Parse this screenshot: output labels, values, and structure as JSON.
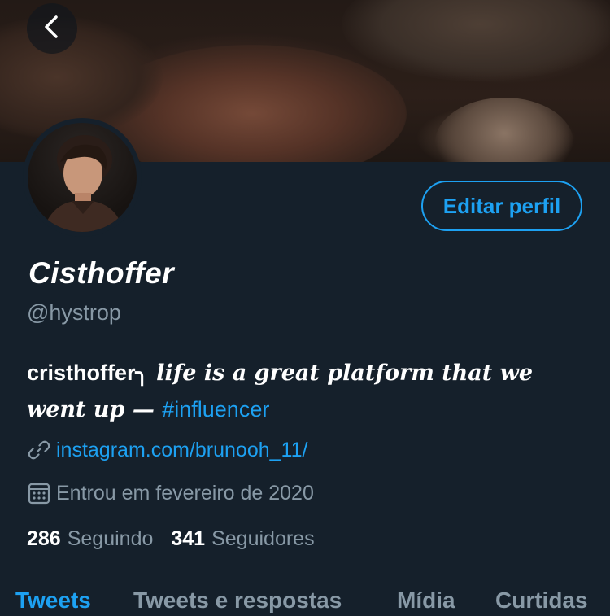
{
  "header": {
    "back_icon": "chevron-left-icon",
    "banner_description": "photo banner"
  },
  "profile": {
    "display_name": "Cisthoffer",
    "handle": "@hystrop",
    "edit_button_label": "Editar perfil",
    "bio": {
      "part1": "cristhoffer╮",
      "part2": " life is a great platform that we went up — ",
      "hashtag": "#influencer"
    },
    "website": "instagram.com/brunooh_11/",
    "joined": "Entrou em fevereiro de 2020",
    "following_count": "286",
    "following_label": "Seguindo",
    "followers_count": "341",
    "followers_label": "Seguidores"
  },
  "tabs": [
    {
      "label": "Tweets",
      "active": true
    },
    {
      "label": "Tweets e respostas",
      "active": false
    },
    {
      "label": "Mídia",
      "active": false
    },
    {
      "label": "Curtidas",
      "active": false
    }
  ],
  "colors": {
    "background": "#15202b",
    "accent": "#1da1f2",
    "secondary_text": "#8899a6"
  }
}
